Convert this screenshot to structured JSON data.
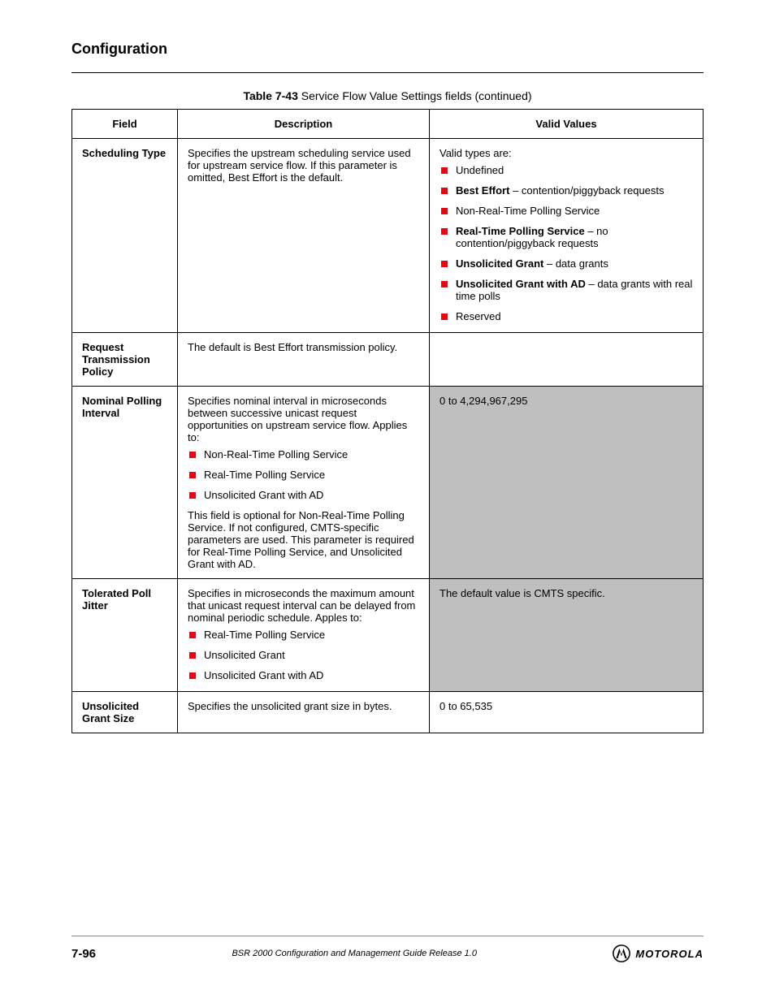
{
  "header": {
    "chapter": "Configuration"
  },
  "caption": {
    "prefix": "Table 7-43",
    "title": "Service Flow Value Settings fields  (continued)"
  },
  "columns": {
    "c1": "Field",
    "c2": "Description",
    "c3": "Valid Values"
  },
  "rows": {
    "r1": {
      "field": "Scheduling Type",
      "desc": "Specifies the upstream scheduling service used for upstream service flow. If this parameter is omitted, Best Effort is the default.",
      "valid_pre": "Valid types are:",
      "items": [
        {
          "text": "Undefined"
        },
        {
          "bold": "Best Effort",
          "text": " – contention/piggyback requests"
        },
        {
          "text": "Non-Real-Time Polling Service"
        },
        {
          "bold": "Real-Time Polling Service",
          "text": " – no contention/piggyback requests"
        },
        {
          "bold": "Unsolicited Grant",
          "text": " – data grants"
        },
        {
          "bold": "Unsolicited Grant with AD",
          "text": " – data grants with real time polls"
        },
        {
          "text": "Reserved"
        }
      ]
    },
    "r2": {
      "field": "Request Transmission Policy",
      "desc": "The default is Best Effort transmission policy."
    },
    "r3": {
      "field": "Nominal Polling Interval",
      "desc_pre": "Specifies nominal interval in microseconds between successive unicast request opportunities on upstream service flow. Applies to:",
      "items": [
        "Non-Real-Time Polling Service",
        "Real-Time Polling Service",
        "Unsolicited Grant with AD"
      ],
      "desc_post": "This field is optional for Non-Real-Time Polling Service. If not configured, CMTS-specific parameters are used. This parameter is required for Real-Time Polling Service, and Unsolicited Grant with AD.",
      "valid": "0 to 4,294,967,295"
    },
    "r4": {
      "field": "Tolerated Poll Jitter",
      "desc_pre": "Specifies in microseconds the maximum amount that unicast request interval can be delayed from nominal periodic schedule. Apples to:",
      "items": [
        "Real-Time Polling Service",
        "Unsolicited Grant",
        "Unsolicited Grant with AD"
      ],
      "valid": "The default value is CMTS specific."
    },
    "r5": {
      "field": "Unsolicited Grant Size",
      "desc": "Specifies the unsolicited grant size in bytes.",
      "valid": "0 to 65,535"
    }
  },
  "footer": {
    "page": "7-96",
    "guide": "BSR 2000 Configuration and Management Guide Release 1.0"
  },
  "logo": {
    "brand": "MOTOROLA"
  }
}
